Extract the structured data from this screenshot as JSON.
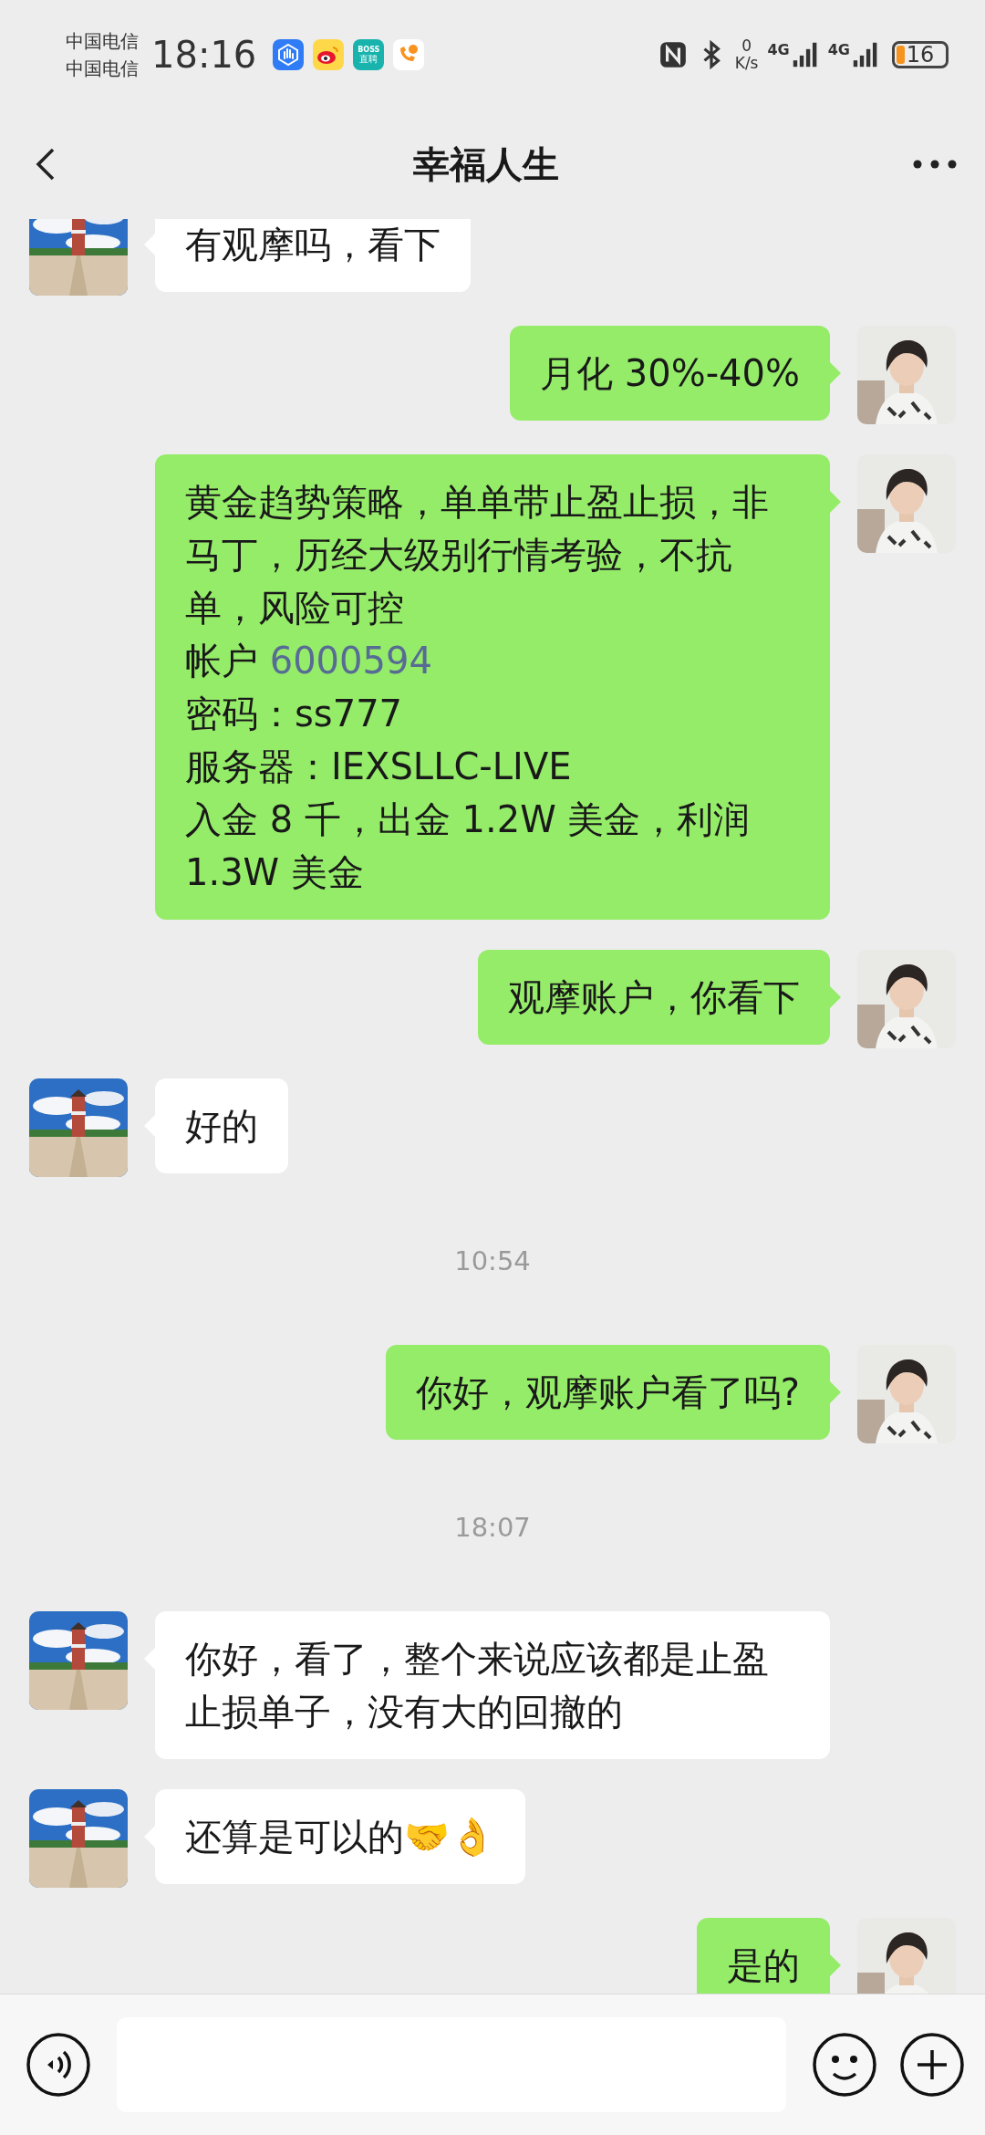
{
  "status_bar": {
    "carriers": [
      "中国电信",
      "中国电信"
    ],
    "time": "18:16",
    "boss_label": [
      "BOSS",
      "直聘"
    ],
    "net_speed": [
      "0",
      "K/s"
    ],
    "network": [
      "4G",
      "4G"
    ],
    "battery": "16"
  },
  "header": {
    "title": "幸福人生"
  },
  "messages": [
    {
      "kind": "message",
      "outgoing": false,
      "paragraphs": [
        {
          "text": "有观摩吗，看下"
        }
      ]
    },
    {
      "kind": "message",
      "outgoing": true,
      "paragraphs": [
        {
          "text": "月化 30%-40%"
        }
      ]
    },
    {
      "kind": "message",
      "outgoing": true,
      "paragraphs": [
        {
          "text": "黄金趋势策略，单单带止盈止损，非马丁，历经大级别行情考验，不抗单，风险可控"
        },
        {
          "text": "帐户 ",
          "link": "6000594"
        },
        {
          "text": "密码：ss777"
        },
        {
          "text": "服务器：IEXSLLC-LIVE"
        },
        {
          "text": "入金 8 千，出金 1.2W 美金，利润 1.3W 美金"
        }
      ]
    },
    {
      "kind": "message",
      "outgoing": true,
      "paragraphs": [
        {
          "text": "观摩账户，你看下"
        }
      ]
    },
    {
      "kind": "message",
      "outgoing": false,
      "paragraphs": [
        {
          "text": "好的"
        }
      ]
    },
    {
      "kind": "time",
      "text": "10:54"
    },
    {
      "kind": "message",
      "outgoing": true,
      "paragraphs": [
        {
          "text": "你好，观摩账户看了吗?"
        }
      ]
    },
    {
      "kind": "time",
      "text": "18:07"
    },
    {
      "kind": "message",
      "outgoing": false,
      "paragraphs": [
        {
          "text": "你好，看了，整个来说应该都是止盈止损单子，没有大的回撤的"
        }
      ]
    },
    {
      "kind": "message",
      "outgoing": false,
      "paragraphs": [
        {
          "text": "还算是可以的🤝👌"
        }
      ]
    },
    {
      "kind": "message",
      "outgoing": true,
      "paragraphs": [
        {
          "text": "是的"
        }
      ]
    }
  ]
}
